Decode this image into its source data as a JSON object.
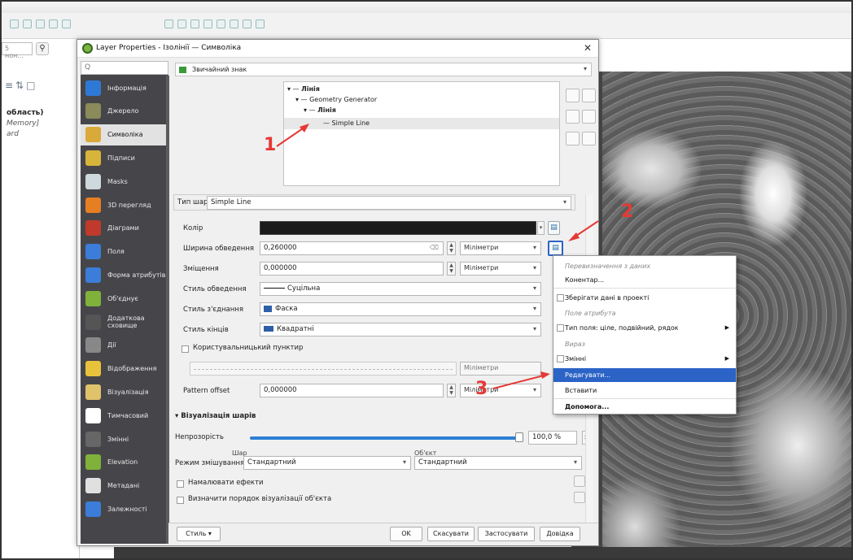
{
  "left": {
    "search_placeholder": "5 нон...",
    "lines": [
      "область)",
      "Memory]",
      "ard"
    ]
  },
  "dialog": {
    "title": "Layer Properties - Ізолінії — Символіка",
    "symbol_type": "Звичайний знак",
    "sidebar_search_placeholder": "Q",
    "sidebar": [
      {
        "label": "Інформація",
        "icon": "info-icon",
        "color": "#2f79d6"
      },
      {
        "label": "Джерело",
        "icon": "source-icon",
        "color": "#8a8a5a"
      },
      {
        "label": "Символіка",
        "icon": "symbology-icon",
        "color": "#d9a93a"
      },
      {
        "label": "Підписи",
        "icon": "labels-icon",
        "color": "#d9b43a"
      },
      {
        "label": "Masks",
        "icon": "masks-icon",
        "color": "#cfd8dc"
      },
      {
        "label": "3D перегляд",
        "icon": "3d-icon",
        "color": "#e67e22"
      },
      {
        "label": "Діаграми",
        "icon": "diagrams-icon",
        "color": "#c0392b"
      },
      {
        "label": "Поля",
        "icon": "fields-icon",
        "color": "#3b7dd8"
      },
      {
        "label": "Форма атрибутів",
        "icon": "attributes-form-icon",
        "color": "#3b7dd8"
      },
      {
        "label": "Об'єднує",
        "icon": "joins-icon",
        "color": "#7fb13b"
      },
      {
        "label": "Додаткова сховище",
        "icon": "auxiliary-storage-icon",
        "color": "#555555"
      },
      {
        "label": "Дії",
        "icon": "actions-icon",
        "color": "#888888"
      },
      {
        "label": "Відображення",
        "icon": "display-icon",
        "color": "#e8c23a"
      },
      {
        "label": "Візуалізація",
        "icon": "rendering-icon",
        "color": "#e0c26a"
      },
      {
        "label": "Тимчасовий",
        "icon": "temporal-icon",
        "color": "#ffffff"
      },
      {
        "label": "Змінні",
        "icon": "variables-icon",
        "color": "#666666"
      },
      {
        "label": "Elevation",
        "icon": "elevation-icon",
        "color": "#7fb13b"
      },
      {
        "label": "Метадані",
        "icon": "metadata-icon",
        "color": "#e0e0e0"
      },
      {
        "label": "Залежності",
        "icon": "dependencies-icon",
        "color": "#3b7dd8"
      }
    ],
    "tree": [
      {
        "text": "Лінія",
        "bold": true
      },
      {
        "text": "Geometry Generator",
        "bold": false
      },
      {
        "text": "Лінія",
        "bold": true
      },
      {
        "text": "Simple Line",
        "bold": false
      }
    ],
    "layer_type_label": "Тип шару",
    "layer_type_value": "Simple Line",
    "color_label": "Колір",
    "stroke_width_label": "Ширина обведення",
    "stroke_width_value": "0,260000",
    "stroke_width_unit": "Міліметри",
    "offset_label": "Зміщення",
    "offset_value": "0,000000",
    "offset_unit": "Міліметри",
    "stroke_style_label": "Стиль обведення",
    "stroke_style_value": "Суцільна",
    "join_style_label": "Стиль з'єднання",
    "join_style_value": "Фаска",
    "cap_style_label": "Стиль кінців",
    "cap_style_value": "Квадратні",
    "custom_dash_label": "Користувальницький пунктир",
    "dash_unit": "Міліметри",
    "pattern_offset_label": "Pattern offset",
    "pattern_offset_value": "0,000000",
    "pattern_offset_unit": "Міліметри",
    "layer_rendering_label": "Візуалізація шарів",
    "opacity_label": "Непрозорість",
    "opacity_value": "100,0 %",
    "opacity_fraction": 1.0,
    "blend_label": "Режим змішування",
    "blend_layer_label": "Шар",
    "blend_layer_value": "Стандартний",
    "blend_object_label": "Об'єкт",
    "blend_object_value": "Стандартний",
    "draw_effects_label": "Намалювати ефекти",
    "order_label": "Визначити порядок візуалізації об'єкта",
    "style_button": "Стиль",
    "ok_button": "OK",
    "cancel_button": "Скасувати",
    "apply_button": "Застосувати",
    "help_button": "Довідка"
  },
  "menu": {
    "items": [
      {
        "label": "Перевизначення з даних",
        "kind": "header"
      },
      {
        "label": "Конентар...",
        "kind": "item"
      },
      {
        "label": "Зберігати дані в проекті",
        "kind": "check"
      },
      {
        "label": "Поле атрибута",
        "kind": "header"
      },
      {
        "label": "Тип поля: ціле, подвійний, рядок",
        "kind": "check-sub"
      },
      {
        "label": "Вираз",
        "kind": "header"
      },
      {
        "label": "Змінні",
        "kind": "check-sub"
      },
      {
        "label": "Редагувати...",
        "kind": "selected"
      },
      {
        "label": "Вставити",
        "kind": "item"
      },
      {
        "label": "Допомога...",
        "kind": "bold"
      }
    ]
  },
  "annotations": [
    "1",
    "2",
    "3"
  ],
  "colors": {
    "selection": "#2b63c6",
    "annotation": "#e53935",
    "sidebar": "#46464a"
  }
}
